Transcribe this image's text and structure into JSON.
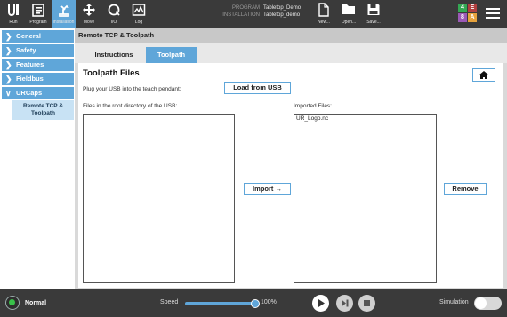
{
  "topbar": {
    "nav": [
      {
        "label": "Run",
        "icon": "ur-logo-icon"
      },
      {
        "label": "Program",
        "icon": "program-icon"
      },
      {
        "label": "Installation",
        "icon": "installation-icon"
      },
      {
        "label": "Move",
        "icon": "move-icon"
      },
      {
        "label": "I/O",
        "icon": "io-icon"
      },
      {
        "label": "Log",
        "icon": "log-icon"
      }
    ],
    "program_key": "PROGRAM",
    "program_value": "Tabletop_Demo",
    "installation_key": "INSTALLATION",
    "installation_value": "Tabletop_demo",
    "file_actions": [
      {
        "label": "New...",
        "icon": "new-file-icon"
      },
      {
        "label": "Open...",
        "icon": "open-folder-icon"
      },
      {
        "label": "Save...",
        "icon": "save-icon"
      }
    ],
    "badges": [
      {
        "text": "4",
        "color": "#34a853"
      },
      {
        "text": "E",
        "color": "#b04040"
      },
      {
        "text": "8",
        "color": "#9b59b6"
      },
      {
        "text": "A",
        "color": "#e6a23c"
      }
    ]
  },
  "sidebar": {
    "items": [
      {
        "label": "General"
      },
      {
        "label": "Safety"
      },
      {
        "label": "Features"
      },
      {
        "label": "Fieldbus"
      },
      {
        "label": "URCaps"
      }
    ],
    "subitem": "Remote TCP & Toolpath"
  },
  "main": {
    "breadcrumb": "Remote TCP & Toolpath",
    "tabs": [
      {
        "label": "Instructions"
      },
      {
        "label": "Toolpath"
      }
    ],
    "active_tab": "Toolpath",
    "title": "Toolpath Files",
    "usb_prompt": "Plug your USB into the teach pendant:",
    "load_button": "Load from USB",
    "usb_list_label": "Files in the root directory of the USB:",
    "imported_label": "Imported Files:",
    "imported_files": [
      "UR_Logo.nc"
    ],
    "import_button": "Import →",
    "remove_button": "Remove"
  },
  "bottombar": {
    "status": "Normal",
    "speed_label": "Speed",
    "speed_value": "100%",
    "speed_fraction": 1.0,
    "simulation_label": "Simulation",
    "simulation_on": false
  },
  "colors": {
    "accent": "#5fa6d9",
    "bar": "#3a3a3a",
    "status_ok": "#39c14a"
  }
}
